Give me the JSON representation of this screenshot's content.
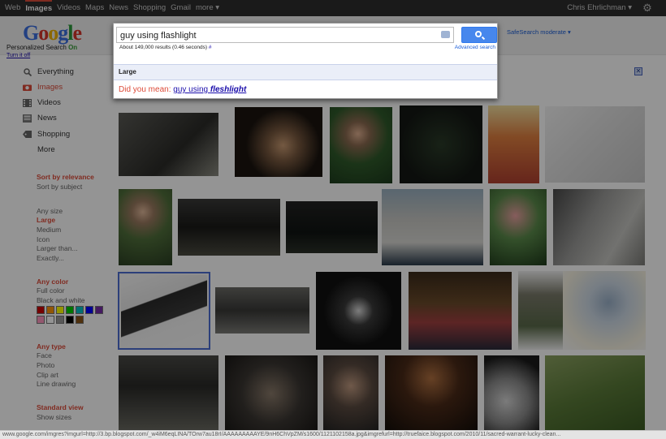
{
  "topbar": {
    "nav": [
      "Web",
      "Images",
      "Videos",
      "Maps",
      "News",
      "Shopping",
      "Gmail",
      "more ▾"
    ],
    "active_index": 1,
    "user": "Chris Ehrlichman ▾"
  },
  "header": {
    "personalized_label": "Personalized Search",
    "personalized_state": "On",
    "turn_off": "Turn it off",
    "safesearch": "SafeSearch moderate ▾"
  },
  "search": {
    "query": "guy using flashlight",
    "results_text": "About 149,000 results (0.46 seconds)",
    "results_hash": "#",
    "advanced": "Advanced search",
    "size_heading": "Large",
    "did_you_mean_prefix": "Did you mean:",
    "did_you_mean_plain": "guy using",
    "did_you_mean_bold": "fleshlight"
  },
  "leftnav": {
    "items": [
      {
        "label": "Everything",
        "icon": "search-icon"
      },
      {
        "label": "Images",
        "icon": "camera-icon"
      },
      {
        "label": "Videos",
        "icon": "film-icon"
      },
      {
        "label": "News",
        "icon": "newspaper-icon"
      },
      {
        "label": "Shopping",
        "icon": "tag-icon"
      }
    ],
    "more": "More",
    "sort": {
      "selected": "Sort by relevance",
      "other": "Sort by subject"
    },
    "size": {
      "any": "Any size",
      "selected": "Large",
      "options": [
        "Medium",
        "Icon",
        "Larger than...",
        "Exactly..."
      ]
    },
    "color": {
      "selected": "Any color",
      "options": [
        "Full color",
        "Black and white"
      ]
    },
    "type": {
      "selected": "Any type",
      "options": [
        "Face",
        "Photo",
        "Clip art",
        "Line drawing"
      ]
    },
    "view": {
      "selected": "Standard view",
      "options": [
        "Show sizes"
      ]
    }
  },
  "swatch_colors": [
    "#cc0000",
    "#fb940b",
    "#ffff00",
    "#00cc00",
    "#03c0c6",
    "#0000ff",
    "#762ca7",
    "#ff98bf",
    "#ffffff",
    "#999999",
    "#000000",
    "#885418"
  ],
  "status_url": "www.google.com/imgres?imgurl=http://3.bp.blogspot.com/_w4iM6eqLINA/TOrw7au18rI/AAAAAAAAAYE/9nH6ChVpZM/s1600/1121102158a.jpg&imgrefurl=http://truefaice.blogspot.com/2010/11/sacred-warrant-lucky-clean..."
}
